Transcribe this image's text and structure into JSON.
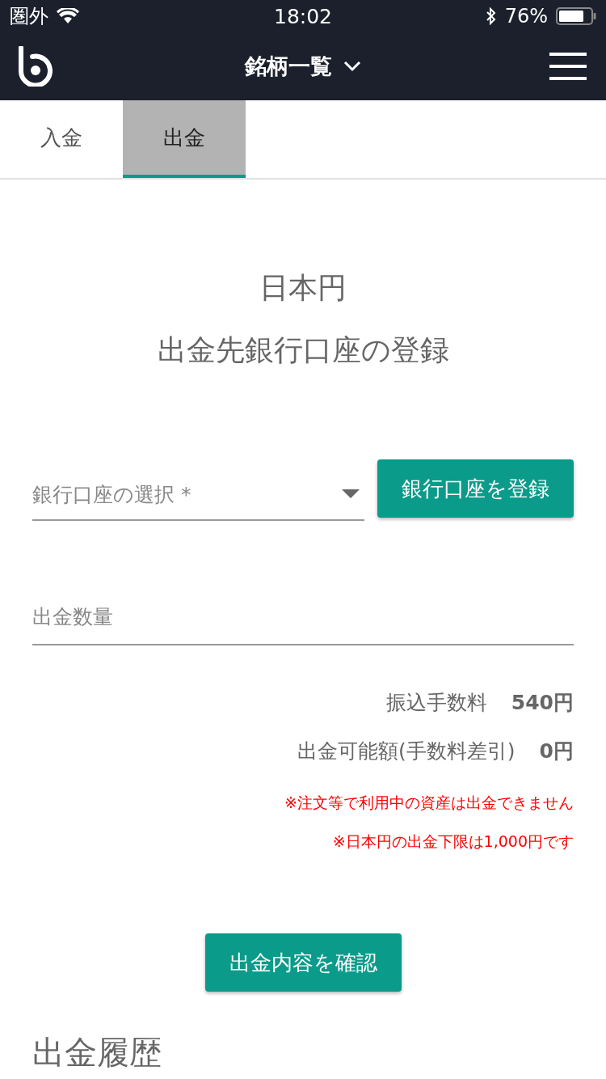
{
  "status_bar": {
    "carrier": "圏外",
    "time": "18:02",
    "battery": "76%"
  },
  "header": {
    "title": "銘柄一覧"
  },
  "tabs": [
    {
      "label": "入金",
      "selected": false
    },
    {
      "label": "出金",
      "selected": true
    }
  ],
  "heading": {
    "currency": "日本円",
    "title": "出金先銀行口座の登録"
  },
  "bank_select": {
    "placeholder": "銀行口座の選択 *"
  },
  "register_button": "銀行口座を登録",
  "amount": {
    "placeholder": "出金数量"
  },
  "summary": [
    {
      "label": "振込手数料",
      "value": "540円"
    },
    {
      "label": "出金可能額(手数料差引)",
      "value": "0円"
    }
  ],
  "notes": [
    "※注文等で利用中の資産は出金できません",
    "※日本円の出金下限は1,000円です"
  ],
  "confirm_button": "出金内容を確認",
  "history_title": "出金履歴"
}
